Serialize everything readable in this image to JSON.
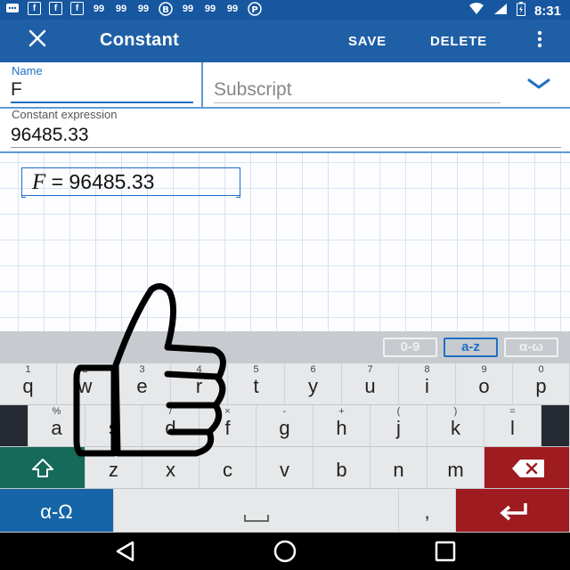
{
  "status_bar": {
    "left_icons": [
      "message-icon",
      "facebook-icon",
      "facebook-icon",
      "facebook-icon",
      "nine-nine-icon",
      "nine-nine-icon",
      "nine-nine-icon",
      "b-icon",
      "nine-nine-icon",
      "nine-nine-icon",
      "nine-nine-icon",
      "pinterest-icon"
    ],
    "time": "8:31"
  },
  "app_bar": {
    "close_icon": "close-icon",
    "title": "Constant",
    "save_label": "SAVE",
    "delete_label": "DELETE",
    "more_icon": "more-vertical-icon"
  },
  "form": {
    "name_label": "Name",
    "name_value": "F",
    "subscript_placeholder": "Subscript",
    "expression_label": "Constant expression",
    "expression_value": "96485.33"
  },
  "canvas": {
    "variable": "F",
    "equals": "=",
    "value": "96485.33"
  },
  "keyboard": {
    "modes": [
      "0-9",
      "a-z",
      "α-ω"
    ],
    "active_mode": "a-z",
    "row1": [
      {
        "label": "q",
        "hint": "1"
      },
      {
        "label": "w",
        "hint": "2"
      },
      {
        "label": "e",
        "hint": "3"
      },
      {
        "label": "r",
        "hint": "4"
      },
      {
        "label": "t",
        "hint": "5"
      },
      {
        "label": "y",
        "hint": "6"
      },
      {
        "label": "u",
        "hint": "7"
      },
      {
        "label": "i",
        "hint": "8"
      },
      {
        "label": "o",
        "hint": "9"
      },
      {
        "label": "p",
        "hint": "0"
      }
    ],
    "row2": [
      {
        "label": "a",
        "hint": "%"
      },
      {
        "label": "s",
        "hint": "!"
      },
      {
        "label": "d",
        "hint": "/"
      },
      {
        "label": "f",
        "hint": "×"
      },
      {
        "label": "g",
        "hint": "-"
      },
      {
        "label": "h",
        "hint": "+"
      },
      {
        "label": "j",
        "hint": "("
      },
      {
        "label": "k",
        "hint": ")"
      },
      {
        "label": "l",
        "hint": "="
      }
    ],
    "row3": [
      "z",
      "x",
      "c",
      "v",
      "b",
      "n",
      "m"
    ],
    "greek_label": "α-Ω",
    "comma_label": ",",
    "accent_teal": "#166a5a",
    "accent_blue": "#1565a8",
    "accent_red": "#9e1b20"
  },
  "nav_bar": {
    "back_icon": "back-triangle-icon",
    "home_icon": "home-circle-icon",
    "recents_icon": "recents-square-icon"
  },
  "colors": {
    "app_bar": "#1f5fa6",
    "accent": "#1f6fc2"
  }
}
